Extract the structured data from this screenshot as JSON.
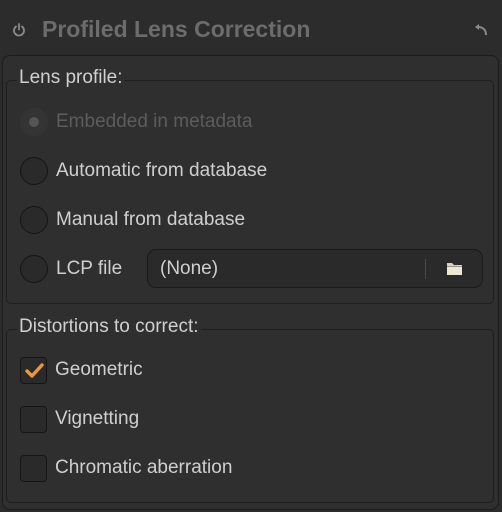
{
  "header": {
    "title": "Profiled Lens Correction",
    "power_icon": "power-icon",
    "reset_icon": "undo-arrow-icon"
  },
  "lens_profile": {
    "label": "Lens profile:",
    "options": [
      {
        "label": "Embedded in metadata",
        "selected": false,
        "enabled": false
      },
      {
        "label": "Automatic from database",
        "selected": false,
        "enabled": true
      },
      {
        "label": "Manual from database",
        "selected": false,
        "enabled": true
      },
      {
        "label": "LCP file",
        "selected": false,
        "enabled": true
      }
    ],
    "lcp_file": {
      "value": "(None)",
      "browse_icon": "folder-icon"
    }
  },
  "distortions": {
    "label": "Distortions to correct:",
    "options": [
      {
        "label": "Geometric",
        "checked": true
      },
      {
        "label": "Vignetting",
        "checked": false
      },
      {
        "label": "Chromatic aberration",
        "checked": false
      }
    ]
  },
  "colors": {
    "background": "#2c2c2c",
    "check_accent": "#e89a3c",
    "title_text": "#6c6c6c"
  }
}
